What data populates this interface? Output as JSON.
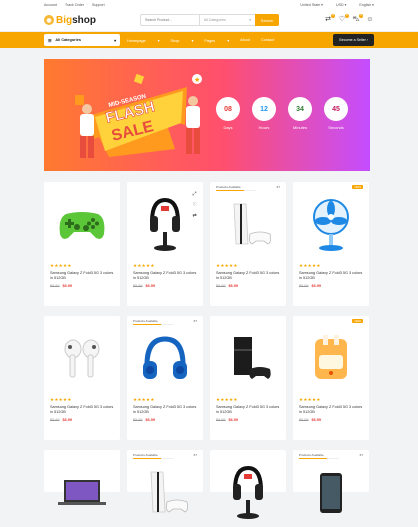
{
  "topbar": {
    "links": [
      "Account",
      "Track Order",
      "Support"
    ],
    "region": "United State",
    "currency": "USD",
    "language": "English"
  },
  "header": {
    "logo_prefix": "Big",
    "logo_suffix": "shop",
    "search_placeholder": "Search Product...",
    "category_placeholder": "All Categories",
    "search_button": "Search",
    "badges": {
      "compare": "2",
      "wishlist": "2",
      "cart": "0"
    }
  },
  "nav": {
    "all_categories": "All Categories",
    "menu": [
      "Homepage",
      "Shop",
      "Pages",
      "About",
      "Contact"
    ],
    "seller": "Become a Seller"
  },
  "banner": {
    "mid": "MID-SEASON",
    "flash": "FLASH",
    "sale": "SALE",
    "countdown": [
      {
        "value": "08",
        "label": "Days"
      },
      {
        "value": "12",
        "label": "Hours"
      },
      {
        "value": "34",
        "label": "Minutes"
      },
      {
        "value": "45",
        "label": "Seconds"
      }
    ]
  },
  "products": [
    {
      "title": "Samsung Galaxy Z Fold3 5G 3 colors in 512GB",
      "old": "$9.99",
      "new": "$6.99",
      "stars": "★★★★★",
      "image": "gamepad"
    },
    {
      "title": "Samsung Galaxy Z Fold3 5G 3 colors in 512GB",
      "old": "$9.99",
      "new": "$6.99",
      "stars": "★★★★★",
      "image": "headset-stand",
      "tools": true
    },
    {
      "title": "Samsung Galaxy Z Fold3 5G 3 colors in 512GB",
      "old": "$9.99",
      "new": "$6.99",
      "stars": "★★★★★",
      "image": "console-white",
      "avail": "Products Available",
      "count": "67",
      "fill": 0.7
    },
    {
      "title": "Samsung Galaxy Z Fold3 5G 3 colors in 512GB",
      "old": "$9.99",
      "new": "$6.99",
      "stars": "★★★★★",
      "image": "fan",
      "hot": "NEW"
    },
    {
      "title": "Samsung Galaxy Z Fold3 5G 3 colors in 512GB",
      "old": "$9.99",
      "new": "$6.99",
      "stars": "★★★★★",
      "image": "earbuds"
    },
    {
      "title": "Samsung Galaxy Z Fold3 5G 3 colors in 512GB",
      "old": "$9.99",
      "new": "$6.99",
      "stars": "★★★★★",
      "image": "headphones",
      "avail": "Products Available",
      "count": "67",
      "fill": 0.7
    },
    {
      "title": "Samsung Galaxy Z Fold3 5G 3 colors in 512GB",
      "old": "$9.99",
      "new": "$6.99",
      "stars": "★★★★★",
      "image": "console-black"
    },
    {
      "title": "Samsung Galaxy Z Fold3 5G 3 colors in 512GB",
      "old": "$9.99",
      "new": "$6.99",
      "stars": "★★★★★",
      "image": "toaster",
      "hot": "NEW"
    },
    {
      "image": "laptop"
    },
    {
      "image": "console-white",
      "avail": "Products Available",
      "count": "67",
      "fill": 0.7
    },
    {
      "image": "headset-stand"
    },
    {
      "image": "phone",
      "avail": "Products Available",
      "count": "67",
      "fill": 0.7
    }
  ],
  "colors": {
    "accent": "#f7a600",
    "price": "#e53935",
    "banner_start": "#ff7a2f",
    "banner_end": "#c44dff"
  }
}
